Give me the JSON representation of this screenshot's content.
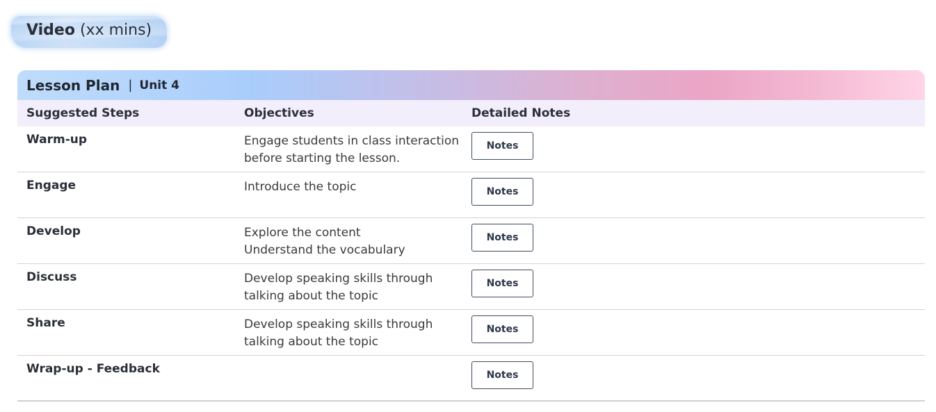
{
  "video": {
    "title": "Video",
    "duration": "(xx mins)"
  },
  "lesson_plan": {
    "title": "Lesson Plan",
    "separator": "|",
    "unit": "Unit 4",
    "columns": [
      "Suggested Steps",
      "Objectives",
      "Detailed Notes"
    ],
    "rows": [
      {
        "step": "Warm-up",
        "objective_lines": [
          "Engage students in class interaction",
          "before starting the lesson."
        ],
        "button": "Notes"
      },
      {
        "step": "Engage",
        "objective_lines": [
          "Introduce the topic",
          ""
        ],
        "button": "Notes"
      },
      {
        "step": "Develop",
        "objective_lines": [
          "Explore the content",
          "Understand the vocabulary"
        ],
        "button": "Notes"
      },
      {
        "step": "Discuss",
        "objective_lines": [
          "Develop speaking skills through",
          "talking about the topic"
        ],
        "button": "Notes"
      },
      {
        "step": "Share",
        "objective_lines": [
          "Develop speaking skills through",
          "talking about the topic"
        ],
        "button": "Notes"
      },
      {
        "step": "Wrap-up - Feedback",
        "objective_lines": [
          "",
          ""
        ],
        "button": "Notes"
      }
    ]
  }
}
